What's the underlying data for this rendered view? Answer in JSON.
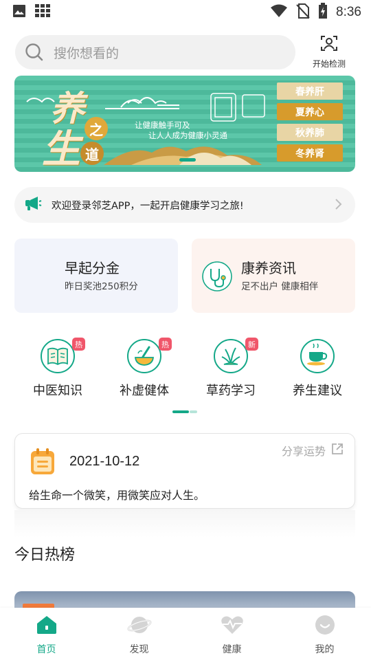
{
  "status_bar": {
    "time": "8:36",
    "icons": [
      "image-icon",
      "apps-grid-icon",
      "wifi-icon",
      "no-sim-icon",
      "battery-charging-icon"
    ]
  },
  "header": {
    "search_placeholder": "搜你想看的",
    "scan_label": "开始检测"
  },
  "banner": {
    "title_char_1": "养",
    "title_char_2": "生",
    "circle_1": "之",
    "circle_2": "道",
    "slogan_line_1": "让健康触手可及",
    "slogan_line_2": "让人人成为健康小灵通",
    "seasons": [
      "春养肝",
      "夏养心",
      "秋养肺",
      "冬养肾"
    ],
    "colors": {
      "background": "#5cc7a9",
      "season_dark": "#d79b2c",
      "season_light": "#e8d5a5"
    }
  },
  "notice": {
    "text": "欢迎登录邻芝APP，一起开启健康学习之旅!"
  },
  "cards": {
    "early": {
      "title": "早起分金",
      "subtitle": "昨日奖池250积分"
    },
    "news": {
      "title": "康养资讯",
      "subtitle": "足不出户 健康相伴"
    }
  },
  "categories": [
    {
      "label": "中医知识",
      "badge": "热",
      "icon": "open-book-icon"
    },
    {
      "label": "补虚健体",
      "badge": "热",
      "icon": "mortar-pestle-icon"
    },
    {
      "label": "草药学习",
      "badge": "新",
      "icon": "herb-plant-icon"
    },
    {
      "label": "养生建议",
      "badge": "",
      "icon": "teacup-icon"
    }
  ],
  "fortune": {
    "date": "2021-10-12",
    "share_label": "分享运势",
    "quote": "给生命一个微笑，用微笑应对人生。"
  },
  "hot_list": {
    "title": "今日热榜"
  },
  "bottom_nav": [
    {
      "label": "首页",
      "icon": "home-icon",
      "active": true
    },
    {
      "label": "发现",
      "icon": "planet-icon",
      "active": false
    },
    {
      "label": "健康",
      "icon": "heartbeat-icon",
      "active": false
    },
    {
      "label": "我的",
      "icon": "profile-smile-icon",
      "active": false
    }
  ],
  "colors": {
    "accent": "#14a888",
    "badge": "#f0566a",
    "card_blue_bg": "#f2f4fb",
    "card_pink_bg": "#fdf3ef"
  }
}
